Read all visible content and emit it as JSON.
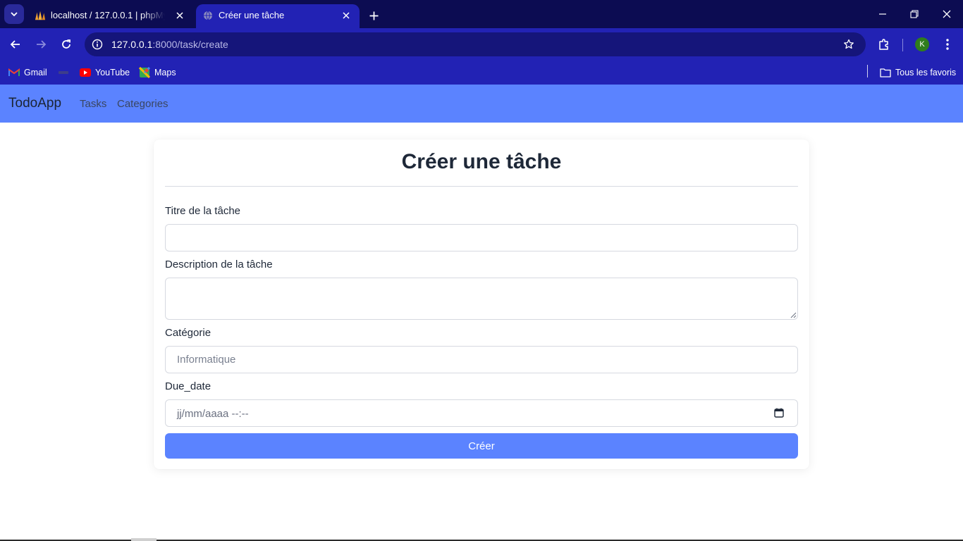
{
  "browser": {
    "tabs": [
      {
        "title": "localhost / 127.0.0.1 | phpMyAdmin",
        "favicon": "phpmyadmin-icon",
        "active": false
      },
      {
        "title": "Créer une tâche",
        "favicon": "globe-icon",
        "active": true
      }
    ],
    "url": {
      "host": "127.0.0.1",
      "path": ":8000/task/create"
    },
    "profile_initial": "K",
    "bookmarks": [
      {
        "label": "Gmail",
        "icon": "gmail-icon"
      },
      {
        "label": "",
        "icon": "site-icon"
      },
      {
        "label": "YouTube",
        "icon": "youtube-icon"
      },
      {
        "label": "Maps",
        "icon": "maps-icon"
      }
    ],
    "all_bookmarks_label": "Tous les favoris",
    "colors": {
      "tabstrip": "#0c0c52",
      "toolbar": "#2222b4",
      "omnibox": "#15157a"
    }
  },
  "app": {
    "brand": "TodoApp",
    "nav_links": [
      "Tasks",
      "Categories"
    ],
    "colors": {
      "accent": "#5b83ff"
    }
  },
  "form": {
    "heading": "Créer une tâche",
    "title_label": "Titre de la tâche",
    "title_value": "",
    "description_label": "Description de la tâche",
    "description_value": "",
    "category_label": "Catégorie",
    "category_placeholder": "Informatique",
    "due_date_label": "Due_date",
    "due_date_placeholder": "jj/mm/aaaa --:--",
    "submit_label": "Créer"
  }
}
